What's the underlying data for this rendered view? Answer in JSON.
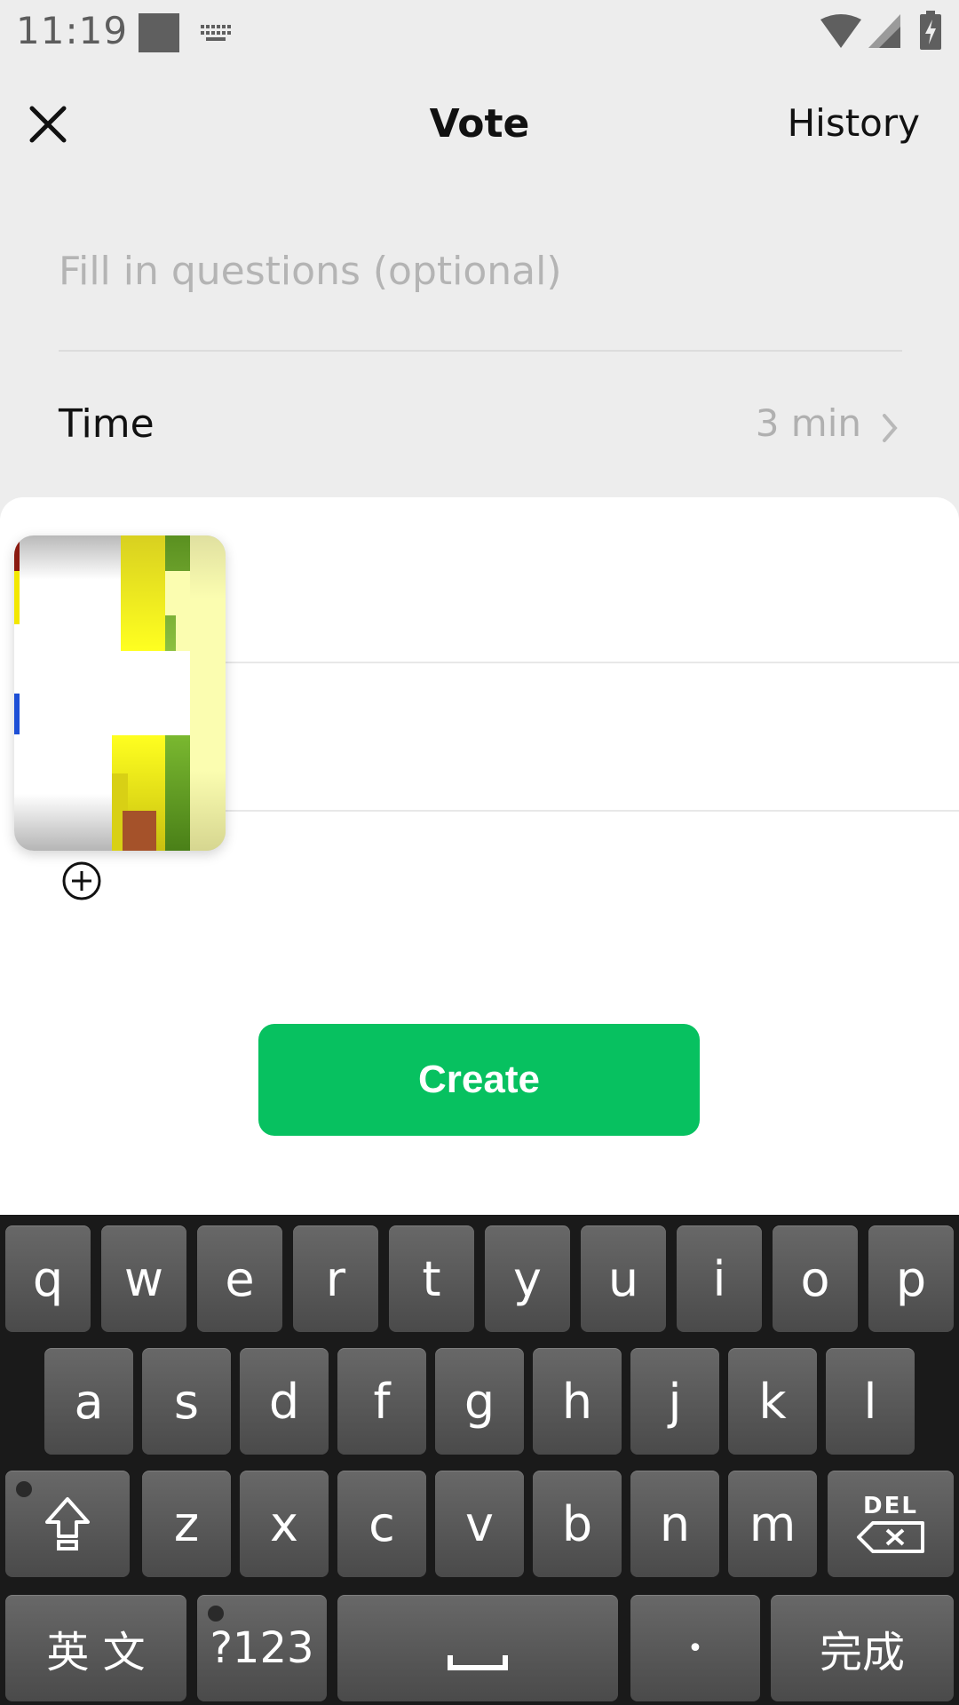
{
  "status_bar": {
    "time": "11:19"
  },
  "header": {
    "title": "Vote",
    "history_label": "History"
  },
  "form": {
    "question_placeholder": "Fill in questions (optional)",
    "time_label": "Time",
    "time_value": "3 min"
  },
  "create_label": "Create",
  "accent_color": "#07c160",
  "keyboard": {
    "row1": [
      "q",
      "w",
      "e",
      "r",
      "t",
      "y",
      "u",
      "i",
      "o",
      "p"
    ],
    "row2": [
      "a",
      "s",
      "d",
      "f",
      "g",
      "h",
      "j",
      "k",
      "l"
    ],
    "row3": [
      "z",
      "x",
      "c",
      "v",
      "b",
      "n",
      "m"
    ],
    "del_label": "DEL",
    "lang_label": "英 文",
    "num_label": "?123",
    "period_label": "•",
    "done_label": "完成"
  }
}
